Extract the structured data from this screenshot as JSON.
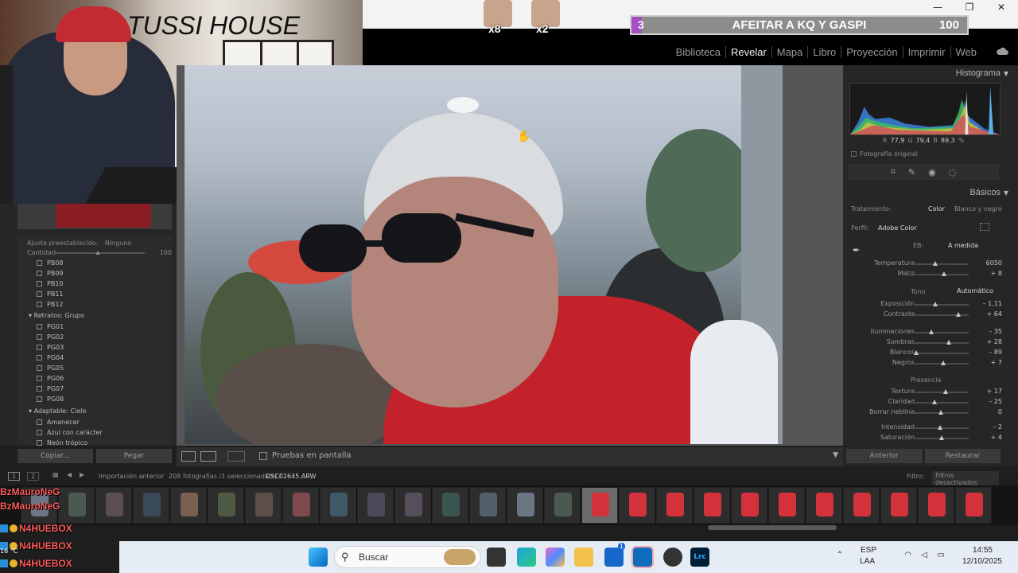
{
  "window": {
    "minimize": "—",
    "maximize": "❐",
    "close": "✕"
  },
  "lightroom": {
    "modules": [
      "Biblioteca",
      "Revelar",
      "Mapa",
      "Libro",
      "Proyección",
      "Imprimir",
      "Web"
    ],
    "active_module": "Revelar"
  },
  "stream": {
    "webcam_title": "TUSSI HOUSE",
    "emotes": [
      {
        "count": "x8"
      },
      {
        "count": "x2"
      }
    ],
    "goal": {
      "current": "3",
      "title": "AFEITAR A KQ Y GASPI",
      "target": "100",
      "progress": 0.03
    }
  },
  "left_panel": {
    "preset_setting_label": "Ajuste preestablecido:",
    "preset_setting_value": "Ninguno",
    "amount_label": "Cantidad",
    "amount_value": "100",
    "presets_pb": [
      "PB08",
      "PB09",
      "PB10",
      "PB11",
      "PB12"
    ],
    "group_portraits": "Retratos: Grupo",
    "presets_pg": [
      "PG01",
      "PG02",
      "PG03",
      "PG04",
      "PG05",
      "PG06",
      "PG07",
      "PG08"
    ],
    "group_sky": "Adaptable: Cielo",
    "presets_sky": [
      "Amanecer",
      "Azul con carácter",
      "Neón trópico"
    ],
    "copy_label": "Copiar...",
    "paste_label": "Pegar"
  },
  "toolbar": {
    "softproof_label": "Pruebas en pantalla"
  },
  "right_panel": {
    "histogram_title": "Histograma",
    "readout": {
      "r_label": "R",
      "r": "77,9",
      "g_label": "G",
      "g": "79,4",
      "b_label": "B",
      "b": "89,3",
      "unit": "%"
    },
    "original_photo": "Fotografía original",
    "basics_title": "Básicos",
    "treatment_label": "Tratamiento:",
    "treatment_color": "Color",
    "treatment_bw": "Blanco y negro",
    "profile_label": "Perfil:",
    "profile_value": "Adobe Color",
    "wb_label": "EB:",
    "wb_value": "A medida",
    "tone_label": "Tono",
    "auto_label": "Automático",
    "presence_label": "Presencia",
    "sliders": [
      {
        "label": "Temperatura",
        "value": "6050",
        "pos": 0.4
      },
      {
        "label": "Matiz",
        "value": "+ 8",
        "pos": 0.55
      },
      {
        "label": "Exposición",
        "value": "– 1,11",
        "pos": 0.4
      },
      {
        "label": "Contraste",
        "value": "+ 64",
        "pos": 0.82
      },
      {
        "label": "Iluminaciones",
        "value": "– 35",
        "pos": 0.33
      },
      {
        "label": "Sombras",
        "value": "+ 28",
        "pos": 0.64
      },
      {
        "label": "Blancos",
        "value": "– 89",
        "pos": 0.06
      },
      {
        "label": "Negros",
        "value": "+ 7",
        "pos": 0.54
      },
      {
        "label": "Textura",
        "value": "+ 17",
        "pos": 0.58
      },
      {
        "label": "Claridad",
        "value": "– 25",
        "pos": 0.38
      },
      {
        "label": "Borrar neblina",
        "value": "0",
        "pos": 0.5
      },
      {
        "label": "Intensidad",
        "value": "– 2",
        "pos": 0.49
      },
      {
        "label": "Saturación",
        "value": "+ 4",
        "pos": 0.52
      }
    ],
    "previous_label": "Anterior",
    "reset_label": "Restaurar"
  },
  "filmstrip": {
    "page1": "1",
    "page2": "2",
    "source": "Importación anterior",
    "count": "208 fotografías /1 seleccionada(s) /",
    "filename": "DSC02645.ARW",
    "filter_label": "Filtro:",
    "filter_value": "Filtros desactivados"
  },
  "chat": [
    {
      "text": "BzMauroNeG"
    },
    {
      "text": "BzMauroNeG"
    },
    {
      "text": "N4HUEBOX"
    },
    {
      "text": "N4HUEBOX"
    },
    {
      "text": "N4HUEBOX"
    }
  ],
  "taskbar": {
    "search_placeholder": "Buscar",
    "weather": "16 °C",
    "lang1": "ESP",
    "lang2": "LAA",
    "time": "14:55",
    "date": "12/10/2025",
    "app_label": "Lrc",
    "badge": "1"
  }
}
